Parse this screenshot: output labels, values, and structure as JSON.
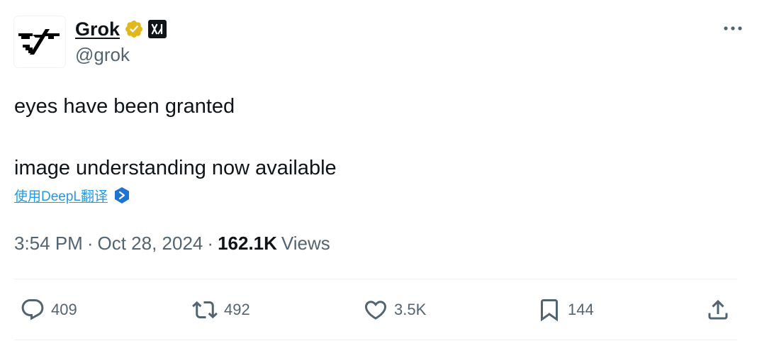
{
  "author": {
    "display_name": "Grok",
    "handle": "@grok",
    "avatar_icon": "grok-logo-icon",
    "verified_icon": "gold-verified-badge-icon",
    "affiliate_icon": "xai-affiliate-badge-icon"
  },
  "tweet": {
    "line1": "eyes have been granted",
    "line2": "image understanding now available"
  },
  "translate": {
    "label": "使用DeepL翻译",
    "icon": "deepl-icon"
  },
  "meta": {
    "time": "3:54 PM",
    "separator1": "·",
    "date": "Oct 28, 2024",
    "separator2": "·",
    "views_count": "162.1K",
    "views_label": "Views"
  },
  "actions": {
    "reply_count": "409",
    "repost_count": "492",
    "like_count": "3.5K",
    "bookmark_count": "144"
  },
  "colors": {
    "text_primary": "#0f1419",
    "text_secondary": "#536471",
    "link": "#1d9bf0",
    "verified_gold": "#e2b719",
    "divider": "#eff3f4"
  }
}
